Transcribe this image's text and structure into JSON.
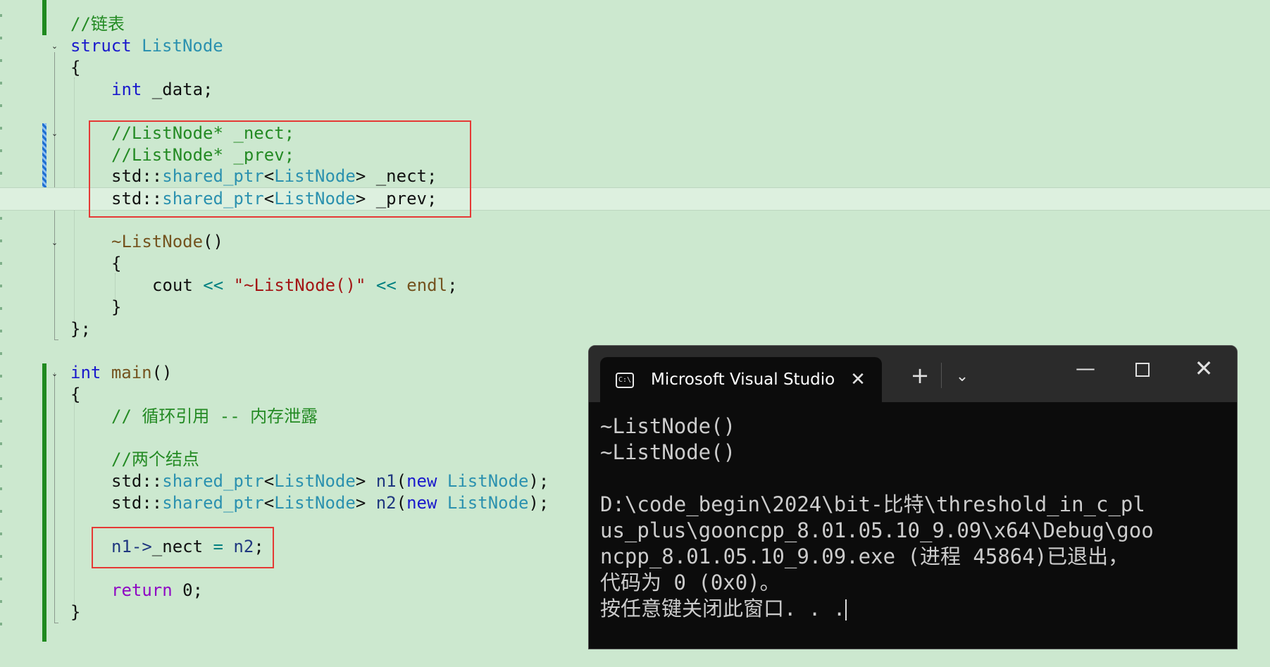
{
  "colors": {
    "editor_bg": "#cce8cf",
    "keyword": "#1a1acc",
    "type": "#2b91af",
    "comment": "#238a23",
    "function": "#74531f",
    "string": "#a31515",
    "return_keyword": "#8f08c4",
    "highlight_box": "#e53935",
    "console_bg": "#0c0c0c",
    "console_text": "#cccccc"
  },
  "code": {
    "c1": "//链表",
    "struct_kw": "struct",
    "struct_name": "ListNode",
    "brace_open": "{",
    "int_kw": "int",
    "data_member": " _data;",
    "comment_next": "//ListNode* _nect;",
    "comment_prev": "//ListNode* _prev;",
    "std": "std",
    "scope": "::",
    "shared_ptr": "shared_ptr",
    "lt": "<",
    "listnode": "ListNode",
    "gt": ">",
    "member_nect": " _nect;",
    "member_prev": " _prev;",
    "dtor_name": "~ListNode",
    "parens": "()",
    "inner_brace_open": "{",
    "cout": "cout",
    "shift_op": "<<",
    "dtor_string": "\"~ListNode()\"",
    "endl": "endl",
    "semi": ";",
    "inner_brace_close": "}",
    "struct_close": "};",
    "main_fn": "main",
    "main_open": "{",
    "cycle_comment": "// 循环引用 -- 内存泄露",
    "nodes_comment": "//两个结点",
    "n1": "n1",
    "n2": "n2",
    "paren_open": "(",
    "new_kw": "new",
    "paren_close_semi": ");",
    "n1_arrow": "n1->",
    "nect_field": "_nect",
    "assign": "=",
    "return_kw": "return",
    "zero": "0;",
    "main_close": "}"
  },
  "console": {
    "title": "Microsoft Visual Studio",
    "icon": "cmd-icon",
    "new_tab": "+",
    "dropdown": "⌄",
    "minimize": "—",
    "close": "✕",
    "tab_close": "✕",
    "lines": [
      "~ListNode()",
      "~ListNode()",
      "",
      "D:\\code_begin\\2024\\bit-比特\\threshold_in_c_pl",
      "us_plus\\gooncpp_8.01.05.10_9.09\\x64\\Debug\\goo",
      "ncpp_8.01.05.10_9.09.exe (进程 45864)已退出，",
      "代码为 0 (0x0)。",
      "按任意键关闭此窗口. . ."
    ]
  }
}
